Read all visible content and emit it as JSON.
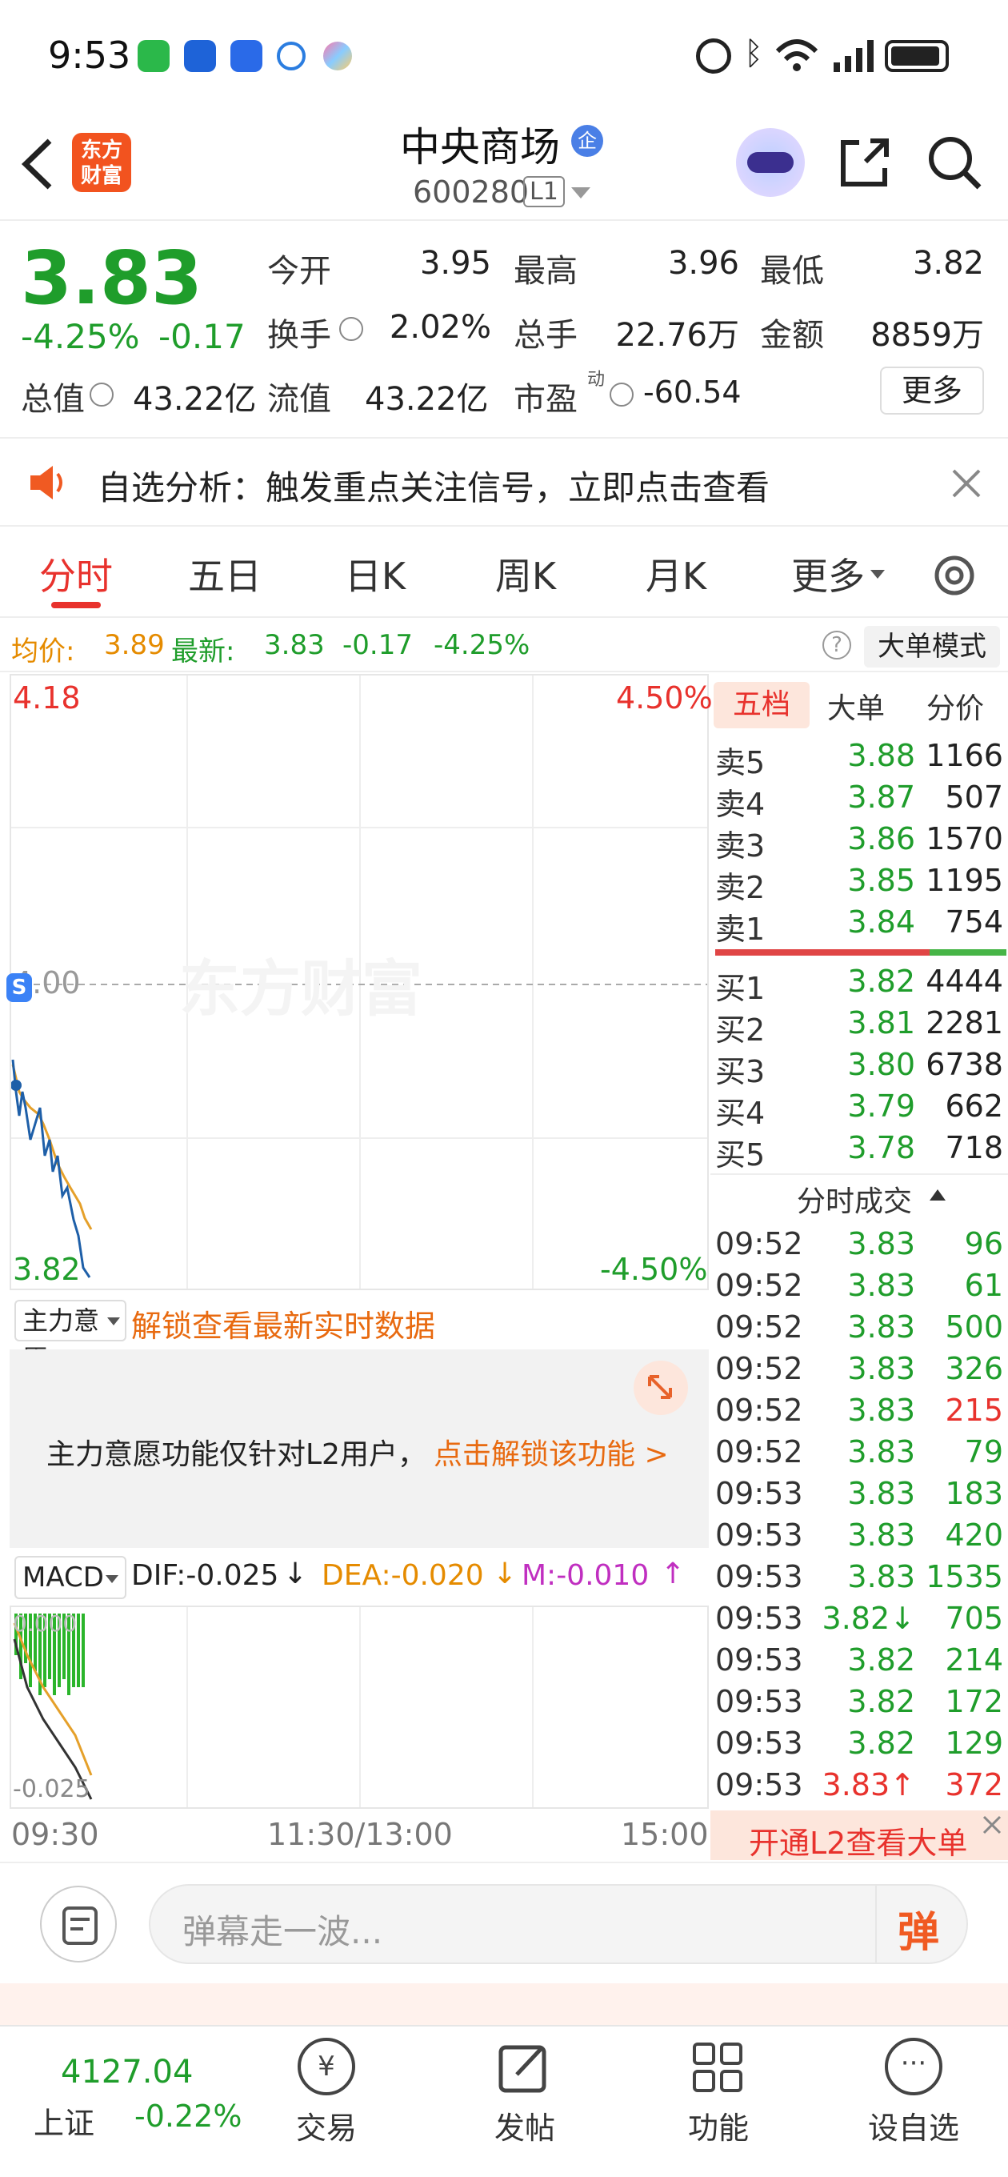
{
  "status_bar": {
    "time": "9:53"
  },
  "header": {
    "title": "中央商场",
    "badge": "企",
    "code": "600280",
    "level": "L1",
    "logo_line1": "东方",
    "logo_line2": "财富"
  },
  "quote": {
    "price": "3.83",
    "change_pct": "-4.25%",
    "change": "-0.17",
    "open_label": "今开",
    "open": "3.95",
    "high_label": "最高",
    "high": "3.96",
    "low_label": "最低",
    "low": "3.82",
    "turnover_label": "换手",
    "turnover": "2.02%",
    "volume_label": "总手",
    "volume": "22.76万",
    "amount_label": "金额",
    "amount": "8859万",
    "mcap_label": "总值",
    "mcap": "43.22亿",
    "float_label": "流值",
    "float": "43.22亿",
    "pe_label": "市盈",
    "pe_sup": "动",
    "pe": "-60.54",
    "more": "更多"
  },
  "notice": {
    "text": "自选分析：触发重点关注信号，立即点击查看"
  },
  "tabs": [
    "分时",
    "五日",
    "日K",
    "周K",
    "月K",
    "更多"
  ],
  "info_bar": {
    "avg_label": "均价:",
    "avg": "3.89",
    "latest_label": "最新:",
    "latest": "3.83",
    "chg": "-0.17",
    "pct": "-4.25%",
    "mode": "大单模式"
  },
  "chart": {
    "top_price": "4.18",
    "top_pct": "4.50%",
    "mid_price": "4.00",
    "bottom_price": "3.82",
    "bottom_pct": "-4.50%",
    "watermark": "东方财富",
    "s_badge": "S",
    "x_labels": [
      "09:30",
      "11:30/13:00",
      "15:00"
    ]
  },
  "zhuli": {
    "select": "主力意愿",
    "unlock": "解锁查看最新实时数据",
    "msg": "主力意愿功能仅针对L2用户，",
    "link": "点击解锁该功能 >"
  },
  "macd": {
    "select": "MACD",
    "dif": "DIF:-0.025",
    "dea": "DEA:-0.020",
    "m": "M:-0.010",
    "zero": "0.000",
    "low": "-0.025"
  },
  "order_tabs": [
    "五档",
    "大单",
    "分价"
  ],
  "asks": [
    {
      "label": "卖5",
      "price": "3.88",
      "vol": "1166"
    },
    {
      "label": "卖4",
      "price": "3.87",
      "vol": "507"
    },
    {
      "label": "卖3",
      "price": "3.86",
      "vol": "1570"
    },
    {
      "label": "卖2",
      "price": "3.85",
      "vol": "1195"
    },
    {
      "label": "卖1",
      "price": "3.84",
      "vol": "754"
    }
  ],
  "bids": [
    {
      "label": "买1",
      "price": "3.82",
      "vol": "4444"
    },
    {
      "label": "买2",
      "price": "3.81",
      "vol": "2281"
    },
    {
      "label": "买3",
      "price": "3.80",
      "vol": "6738"
    },
    {
      "label": "买4",
      "price": "3.79",
      "vol": "662"
    },
    {
      "label": "买5",
      "price": "3.78",
      "vol": "718"
    }
  ],
  "trades_title": "分时成交",
  "trades": [
    {
      "t": "09:52",
      "p": "3.83",
      "v": "96",
      "vc": "green"
    },
    {
      "t": "09:52",
      "p": "3.83",
      "v": "61",
      "vc": "green"
    },
    {
      "t": "09:52",
      "p": "3.83",
      "v": "500",
      "vc": "green"
    },
    {
      "t": "09:52",
      "p": "3.83",
      "v": "326",
      "vc": "green"
    },
    {
      "t": "09:52",
      "p": "3.83",
      "v": "215",
      "vc": "red"
    },
    {
      "t": "09:52",
      "p": "3.83",
      "v": "79",
      "vc": "green"
    },
    {
      "t": "09:53",
      "p": "3.83",
      "v": "183",
      "vc": "green"
    },
    {
      "t": "09:53",
      "p": "3.83",
      "v": "420",
      "vc": "green"
    },
    {
      "t": "09:53",
      "p": "3.83",
      "v": "1535",
      "vc": "green"
    },
    {
      "t": "09:53",
      "p": "3.82↓",
      "v": "705",
      "vc": "green"
    },
    {
      "t": "09:53",
      "p": "3.82",
      "v": "214",
      "vc": "green"
    },
    {
      "t": "09:53",
      "p": "3.82",
      "v": "172",
      "vc": "green"
    },
    {
      "t": "09:53",
      "p": "3.82",
      "v": "129",
      "vc": "green"
    },
    {
      "t": "09:53",
      "p": "3.83↑",
      "v": "372",
      "vc": "red"
    }
  ],
  "l2_banner": "开通L2查看大单",
  "comment": {
    "placeholder": "弹幕走一波...",
    "send": "弹"
  },
  "bottom_nav": {
    "index_value": "4127.04",
    "index_name": "上证",
    "index_change": "-0.22%",
    "items": [
      "交易",
      "发帖",
      "功能",
      "设自选"
    ]
  }
}
